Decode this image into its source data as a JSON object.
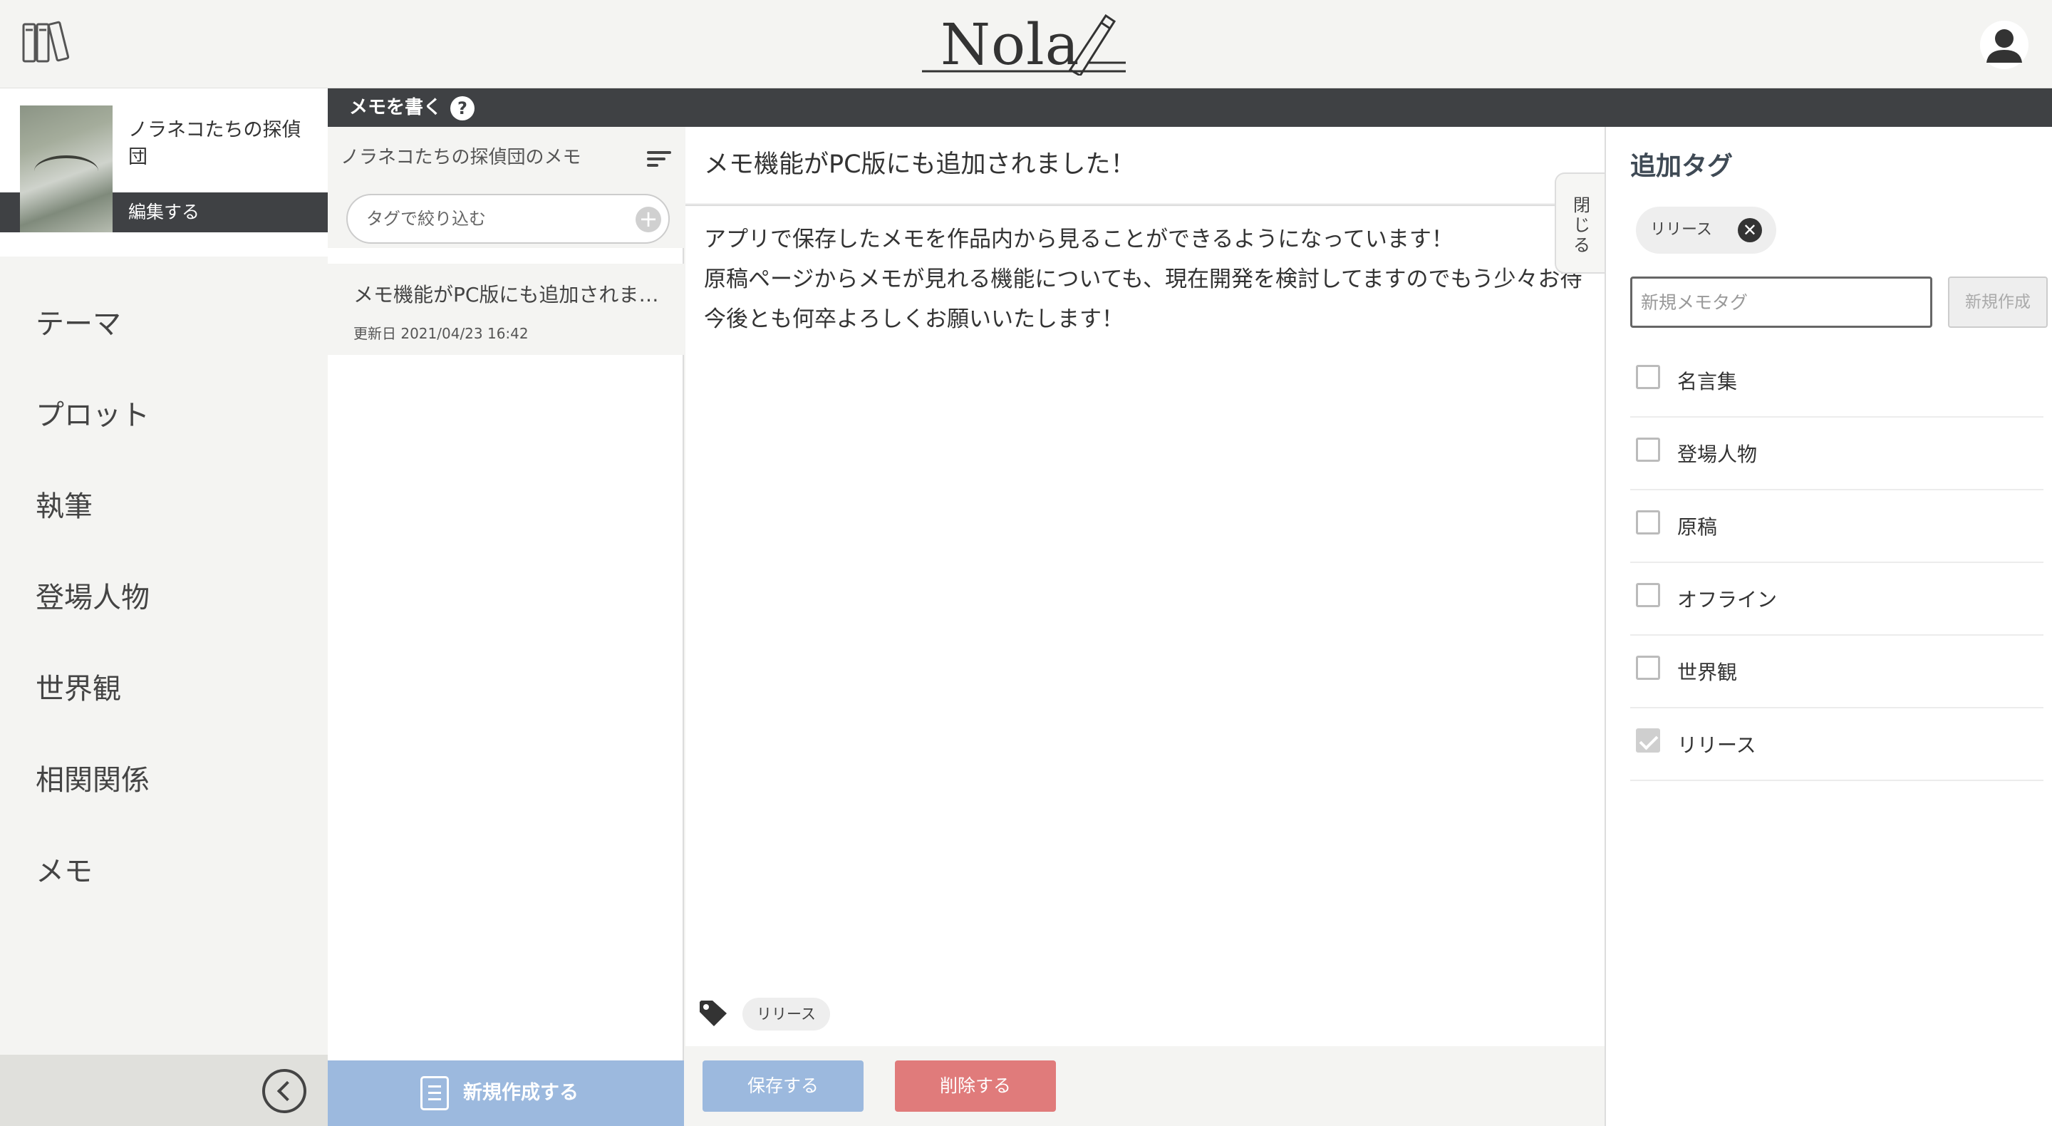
{
  "header": {
    "logo_text": "Nola",
    "icons": {
      "library": "books-icon",
      "account": "avatar-icon"
    }
  },
  "sidebar": {
    "project_title": "ノラネコたちの探偵団",
    "edit_label": "編集する",
    "items": [
      {
        "label": "テーマ"
      },
      {
        "label": "プロット"
      },
      {
        "label": "執筆"
      },
      {
        "label": "登場人物"
      },
      {
        "label": "世界観"
      },
      {
        "label": "相関関係"
      },
      {
        "label": "メモ"
      }
    ],
    "collapse_icon": "chevron-left-circle-icon"
  },
  "section": {
    "title": "メモを書く",
    "help_glyph": "?"
  },
  "memo_list": {
    "title": "ノラネコたちの探偵団のメモ",
    "filter_placeholder": "タグで絞り込む",
    "filter_add_glyph": "+",
    "items": [
      {
        "title": "メモ機能がPC版にも追加されまし…",
        "date": "更新日 2021/04/23 16:42"
      }
    ],
    "new_button_label": "新規作成する"
  },
  "editor": {
    "title": "メモ機能がPC版にも追加されました！",
    "body_lines": [
      "アプリで保存したメモを作品内から見ることができるようになっています！",
      "原稿ページからメモが見れる機能についても、現在開発を検討してますのでもう少々お待",
      "今後とも何卒よろしくお願いいたします！"
    ],
    "tags": [
      "リリース"
    ],
    "save_label": "保存する",
    "delete_label": "削除する"
  },
  "tag_panel": {
    "close_label": "閉じる",
    "title": "追加タグ",
    "selected_tags": [
      "リリース"
    ],
    "remove_glyph": "✕",
    "new_tag_placeholder": "新規メモタグ",
    "new_tag_value": "",
    "create_label": "新規作成",
    "options": [
      {
        "label": "名言集",
        "checked": false
      },
      {
        "label": "登場人物",
        "checked": false
      },
      {
        "label": "原稿",
        "checked": false
      },
      {
        "label": "オフライン",
        "checked": false
      },
      {
        "label": "世界観",
        "checked": false
      },
      {
        "label": "リリース",
        "checked": true
      }
    ]
  },
  "colors": {
    "dark_bar": "#3f4144",
    "primary_button": "#9cb9de",
    "danger_button": "#e07b7b",
    "background": "#f4f4f2"
  }
}
